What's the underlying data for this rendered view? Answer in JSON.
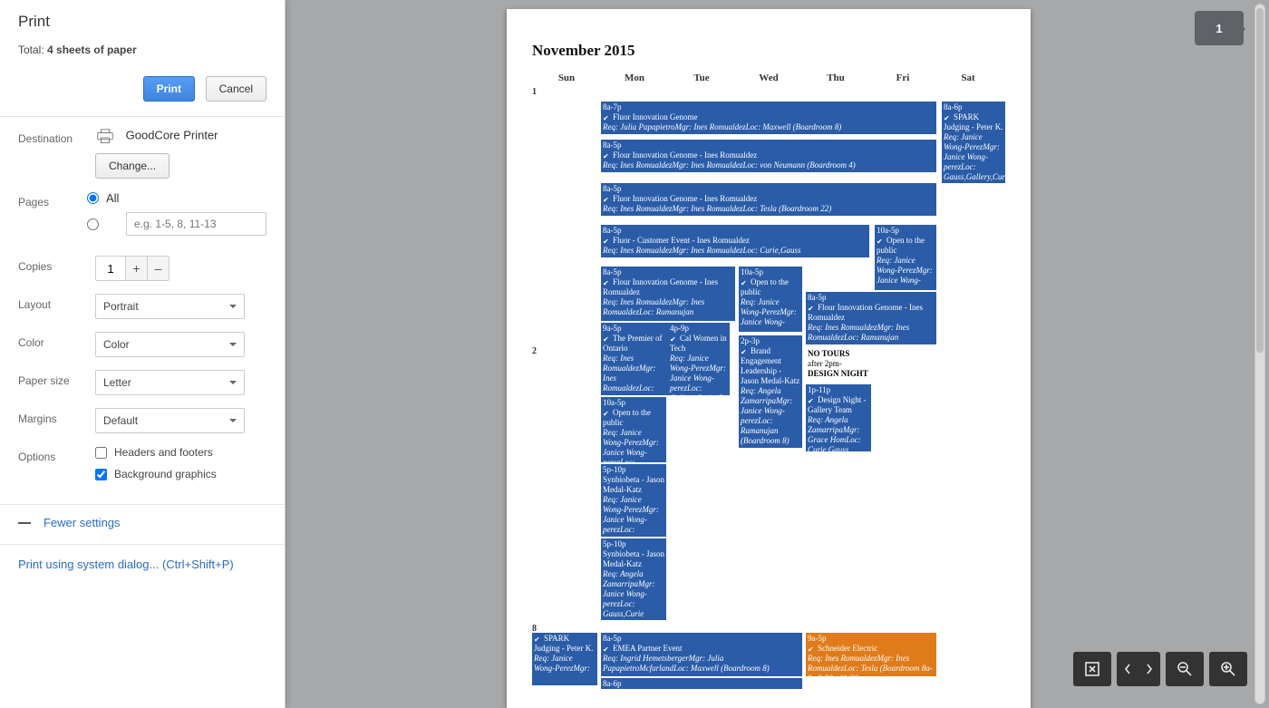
{
  "dialog": {
    "title": "Print",
    "total_prefix": "Total: ",
    "total_bold": "4 sheets of paper",
    "print_btn": "Print",
    "cancel_btn": "Cancel"
  },
  "destination": {
    "label": "Destination",
    "printer": "GoodCore Printer",
    "change": "Change..."
  },
  "pages": {
    "label": "Pages",
    "all_label": "All",
    "range_placeholder": "e.g. 1-5, 8, 11-13"
  },
  "copies": {
    "label": "Copies",
    "value": "1",
    "plus": "+",
    "minus": "–"
  },
  "layout": {
    "label": "Layout",
    "value": "Portrait"
  },
  "color": {
    "label": "Color",
    "value": "Color"
  },
  "paper": {
    "label": "Paper size",
    "value": "Letter"
  },
  "margins": {
    "label": "Margins",
    "value": "Default"
  },
  "options": {
    "label": "Options",
    "headers_footers": "Headers and footers",
    "bg_graphics": "Background graphics"
  },
  "fewer": "Fewer settings",
  "system_print": "Print using system dialog... (Ctrl+Shift+P)",
  "page_number": "1",
  "calendar": {
    "title": "November 2015",
    "days": [
      "Sun",
      "Mon",
      "Tue",
      "Wed",
      "Thu",
      "Fri",
      "Sat"
    ],
    "week_numbers": [
      "1",
      "2",
      "8"
    ]
  },
  "events": {
    "e1": {
      "time": "8a-7p",
      "title": "Fluor Innovation Genome",
      "line3": "Req: Julia PapapietroMgr: Ines RomualdezLoc: Maxwell (Boardroom 8)"
    },
    "e2": {
      "time": "8a-5p",
      "title": "Flour Innovation Genome - Ines Romualdez",
      "line3": "Req: Ines RomualdezMgr: Ines RomualdezLoc: von Neumann (Boardroom 4)"
    },
    "e3": {
      "time": "8a-5p",
      "title": "Fluor Innovation Genome - Ines Romualdez",
      "line3": "Req: Ines RomualdezMgr: Ines RomualdezLoc: Tesla (Boardroom 22)"
    },
    "e4": {
      "time": "8a-5p",
      "title": "Fluor - Customer Event - Ines Romualdez",
      "line3": "Req: Ines RomualdezMgr: Ines RomualdezLoc: Curie,Gauss"
    },
    "e5": {
      "time": "8a-5p",
      "title": "Flour Innovation Genome - Ines Romualdez",
      "line3": "Req: Ines RomualdezMgr: Ines RomualdezLoc: Ramanujan"
    },
    "e5b": {
      "time": "9a-5p",
      "title": "The Premier of Ontario",
      "line3": "Req: Ines RomualdezMgr: Ines RomualdezLoc:"
    },
    "e6": {
      "time": "4p-9p",
      "title": "Cal Women in Tech",
      "line3": "Req: Janice Wong-PerezMgr: Janice Wong-perezLoc: Gallery,Curie,G"
    },
    "e7": {
      "time": "10a-5p",
      "title": "Open to the public",
      "line3": "Req: Janice Wong-PerezMgr: Janice Wong-"
    },
    "e7b": {
      "time": "2p-3p",
      "title": "Brand Engagement Leadership - Jason Medal-Katz",
      "line3": "Req: Angela ZamarripaMgr: Janice Wong-perezLoc: Ramanujan (Boardroom 8)"
    },
    "e8": {
      "time": "8a-5p",
      "title": "Flour Innovation Genome - Ines Romualdez",
      "line3": "Req: Ines RomualdezMgr: Ines RomualdezLoc: Ramanujan"
    },
    "e8b": {
      "titleA": "NO TOURS",
      "titleB": "after 2pm-",
      "titleC": "DESIGN NIGHT"
    },
    "e8c": {
      "time": "1p-11p",
      "title": "Design Night - Gallery Team",
      "line3": "Req: Angela ZamarripaMgr: Grace HomLoc: Curie,Gauss"
    },
    "e9": {
      "time": "10a-5p",
      "title": "Open to the public",
      "line3": "Req: Janice Wong-PerezMgr: Janice Wong-"
    },
    "e10": {
      "time": "8a-6p",
      "title": "SPARK Judging - Peter K.",
      "line3": "Req: Janice Wong-PerezMgr: Janice Wong-perezLoc: Gauss,Gallery,Cur"
    },
    "e11": {
      "time": "10a-5p",
      "title": "Open to the public",
      "line3": "Req: Janice Wong-PerezMgr: Janice Wong-perezLoc:"
    },
    "e12": {
      "time": "5p-10p",
      "title": "Synbiobeta - Jason Medal-Katz",
      "line3": "Req: Janice Wong-PerezMgr: Janice Wong-perezLoc:"
    },
    "e12b": {
      "time": "5p-10p",
      "title": "Synbiobeta - Jason Medal-Katz",
      "line3": "Req: Angela ZamarripaMgr: Janice Wong-perezLoc: Gauss,Curie"
    },
    "e13": {
      "title": "SPARK Judging - Peter K.",
      "line3": "Req: Janice Wong-PerezMgr:"
    },
    "e14": {
      "time": "8a-5p",
      "title": "EMEA Partner Event",
      "line3": "Req: Ingrid HemetsbergerMgr: Julia PapapietroMcfarlandLoc: Maxwell (Boardroom 8)"
    },
    "e14b": {
      "time": "8a-6p"
    },
    "e15": {
      "time": "9a-5p",
      "title": "Schneider Electric",
      "line3": "Req: Ines RomualdezMgr: Ines RomualdezLoc: Tesla (Boardroom 8a-8p          8:30a-11:30a"
    }
  }
}
